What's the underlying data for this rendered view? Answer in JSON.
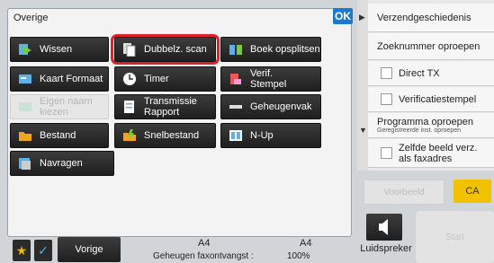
{
  "panel": {
    "title": "Overige",
    "ok_label": "OK"
  },
  "functions": {
    "wissen": "Wissen",
    "dubbelz_scan": "Dubbelz. scan",
    "boek_opsplitsen": "Boek opsplitsen",
    "kaart_formaat": "Kaart Formaat",
    "timer": "Timer",
    "verif_stempel": "Verif. Stempel",
    "eigen_naam": "Eigen naam kiezen",
    "transmissie_rapport": "Transmissie Rapport",
    "geheugenvak": "Geheugenvak",
    "bestand": "Bestand",
    "snelbestand": "Snelbestand",
    "n_up": "N-Up",
    "navragen": "Navragen"
  },
  "right_panel": {
    "verzendgeschiedenis": "Verzendgeschiedenis",
    "zoeknummer": "Zoeknummer oproepen",
    "direct_tx": "Direct TX",
    "verificatiestempel": "Verificatiestempel",
    "programma_oproepen": "Programma oproepen",
    "programma_sub": "Geregistreerde inst. oproepen",
    "zelfde_beeld": "Zelfde beeld verz. als faxadres"
  },
  "actions": {
    "voorbeeld": "Voorbeeld",
    "ca": "CA",
    "luidspreker": "Luidspreker",
    "start": "Start",
    "vorige": "Vorige"
  },
  "status": {
    "paper_left": "A4",
    "paper_right": "A4",
    "memory_label": "Geheugen faxontvangst :",
    "memory_value": "100%"
  },
  "colors": {
    "ok_blue": "#1f78c8",
    "highlight_red": "#e0202a",
    "ca_yellow": "#f2c200"
  }
}
